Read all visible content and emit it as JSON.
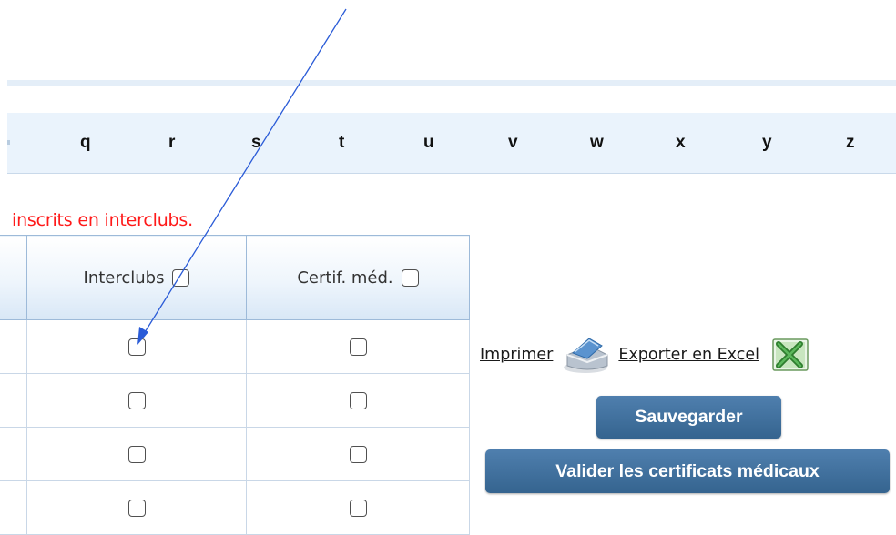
{
  "alphabet": [
    "q",
    "r",
    "s",
    "t",
    "u",
    "v",
    "w",
    "x",
    "y",
    "z"
  ],
  "notice": "inscrits en interclubs.",
  "table": {
    "headers": {
      "interclubs": "Interclubs",
      "certif": "Certif. méd."
    },
    "rows": 4
  },
  "actions": {
    "print": "Imprimer",
    "export": "Exporter en Excel",
    "save": "Sauvegarder",
    "validate": "Valider les certificats médicaux"
  },
  "icons": {
    "print": "printer-icon",
    "excel": "excel-icon"
  },
  "colors": {
    "notice": "#ff1a1a",
    "button": "#3f6f9d",
    "annotation_arrow": "#2a5bd7"
  }
}
